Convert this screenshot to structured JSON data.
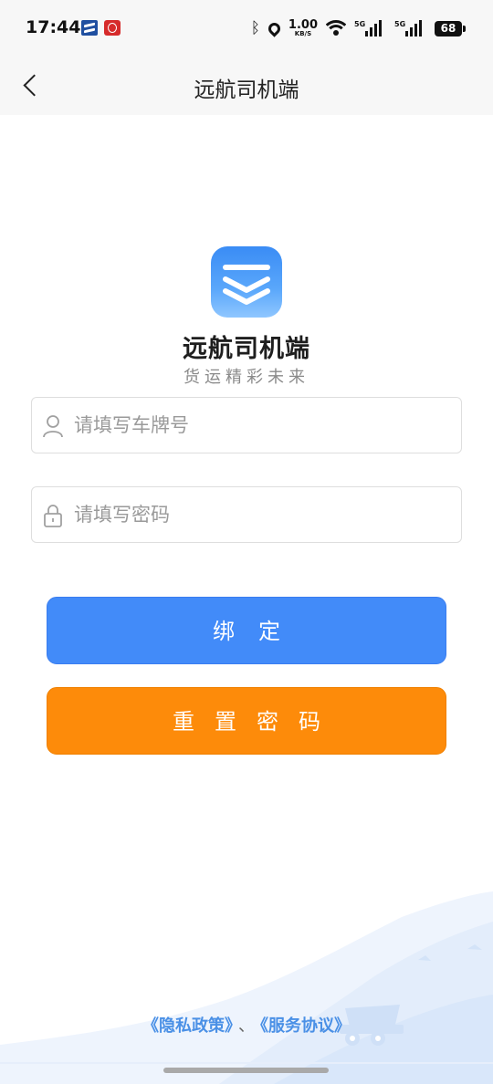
{
  "status_bar": {
    "time": "17:44",
    "network_speed": "1.00",
    "network_speed_unit": "KB/S",
    "signal_label_1": "5G",
    "signal_label_2": "5G",
    "battery": "68",
    "icons": [
      "app-notification-icon",
      "app-notification-icon-2",
      "bluetooth-icon",
      "location-icon",
      "wifi-icon",
      "signal-icon",
      "battery-icon"
    ]
  },
  "nav": {
    "back_icon": "chevron-left-icon",
    "title": "远航司机端"
  },
  "brand": {
    "logo_icon": "app-logo-icon",
    "name": "远航司机端",
    "slogan": "货运精彩未来"
  },
  "form": {
    "plate_placeholder": "请填写车牌号",
    "plate_value": "",
    "plate_icon": "user-icon",
    "password_placeholder": "请填写密码",
    "password_value": "",
    "password_icon": "lock-icon"
  },
  "buttons": {
    "bind": "绑定",
    "reset_password": "重置密码"
  },
  "footer": {
    "privacy_link": "《隐私政策》",
    "separator": "、",
    "service_link": "《服务协议》"
  },
  "colors": {
    "primary_blue": "#428bf9",
    "accent_orange": "#fd8b0a",
    "link_blue": "#4a90e6"
  }
}
